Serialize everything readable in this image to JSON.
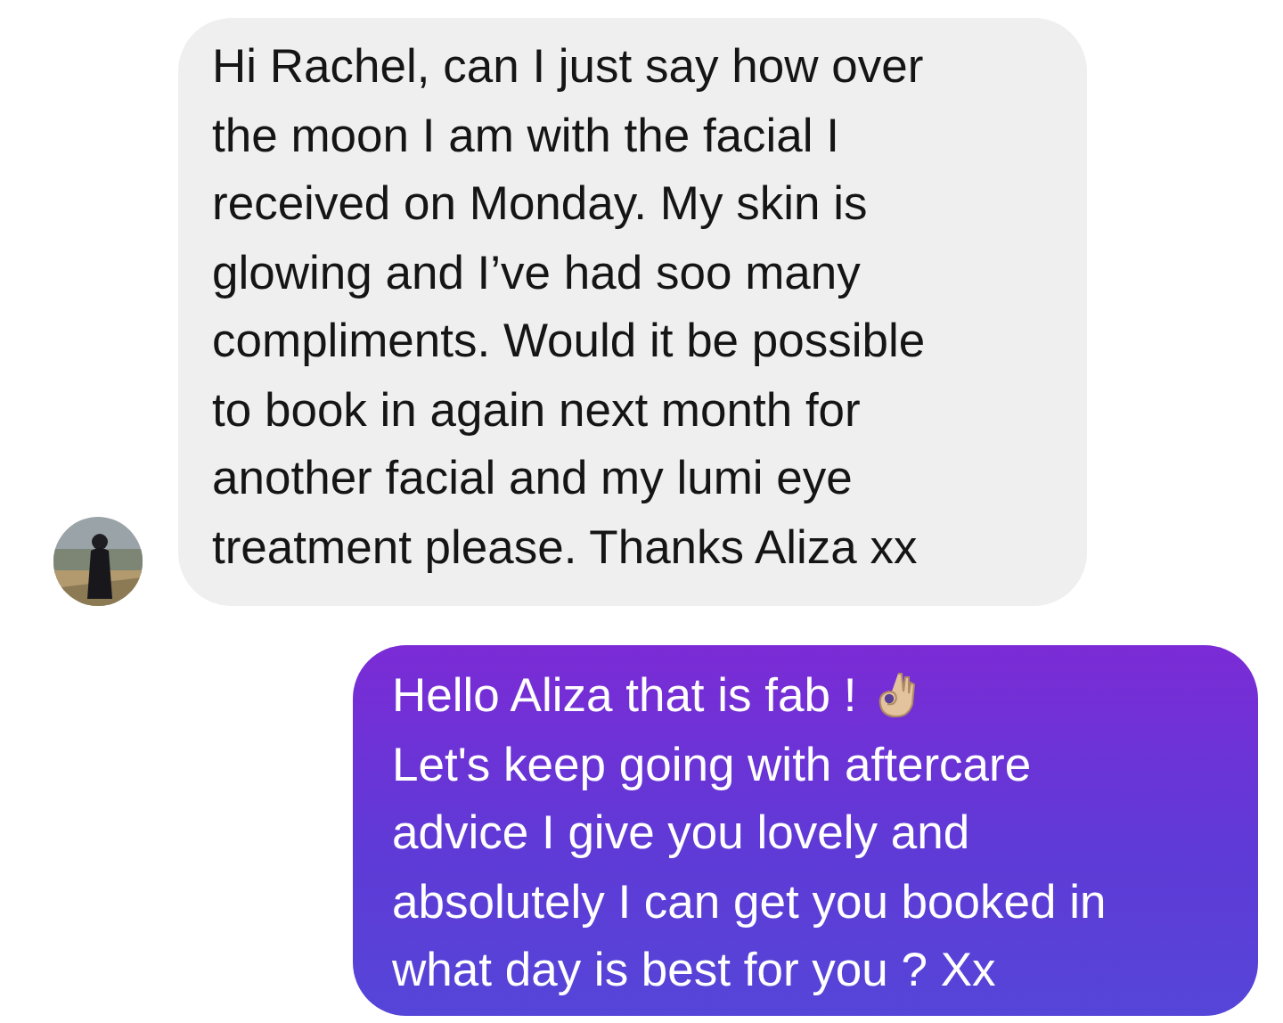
{
  "messages": [
    {
      "kind": "received",
      "avatar": {
        "kind": "picture"
      },
      "parts": [
        {
          "kind": "text",
          "text": "Hi Rachel, can I just say how over\nthe moon I am with the facial I\nreceived on Monday. My skin is\nglowing and I’ve had soo many\ncompliments. Would it be possible\nto book in again next month for\nanother facial and my lumi eye\ntreatment please. Thanks Aliza xx"
        }
      ]
    },
    {
      "kind": "sent",
      "parts": [
        {
          "kind": "text",
          "text": "Hello Aliza that is fab !"
        },
        {
          "kind": "icon"
        },
        {
          "kind": "text",
          "text": "Let's keep going with aftercare\nadvice I give you lovely and\nabsolutely I can get you booked in\nwhat day is best for you ? Xx"
        }
      ]
    }
  ]
}
